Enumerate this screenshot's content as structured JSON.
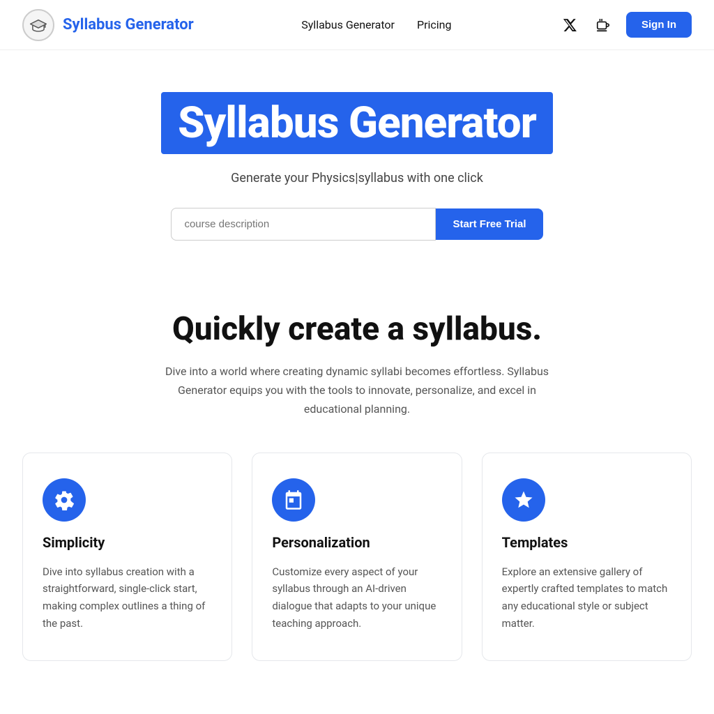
{
  "navbar": {
    "brand": "Syllabus Generator",
    "links": [
      {
        "label": "Syllabus Generator",
        "id": "nav-syllabus"
      },
      {
        "label": "Pricing",
        "id": "nav-pricing"
      }
    ],
    "sign_in_label": "Sign In"
  },
  "hero": {
    "title": "Syllabus Generator",
    "subtitle": "Generate your Physics|syllabus with one click",
    "input_placeholder": "course description",
    "cta_label": "Start Free Trial"
  },
  "features": {
    "heading": "Quickly create a syllabus.",
    "description": "Dive into a world where creating dynamic syllabi becomes effortless. Syllabus Generator equips you with the tools to innovate, personalize, and excel in educational planning.",
    "cards": [
      {
        "id": "card-simplicity",
        "icon": "gear",
        "title": "Simplicity",
        "body": "Dive into syllabus creation with a straightforward, single-click start, making complex outlines a thing of the past."
      },
      {
        "id": "card-personalization",
        "icon": "calendar",
        "title": "Personalization",
        "body": "Customize every aspect of your syllabus through an AI-driven dialogue that adapts to your unique teaching approach."
      },
      {
        "id": "card-templates",
        "icon": "star",
        "title": "Templates",
        "body": "Explore an extensive gallery of expertly crafted templates to match any educational style or subject matter."
      }
    ]
  }
}
